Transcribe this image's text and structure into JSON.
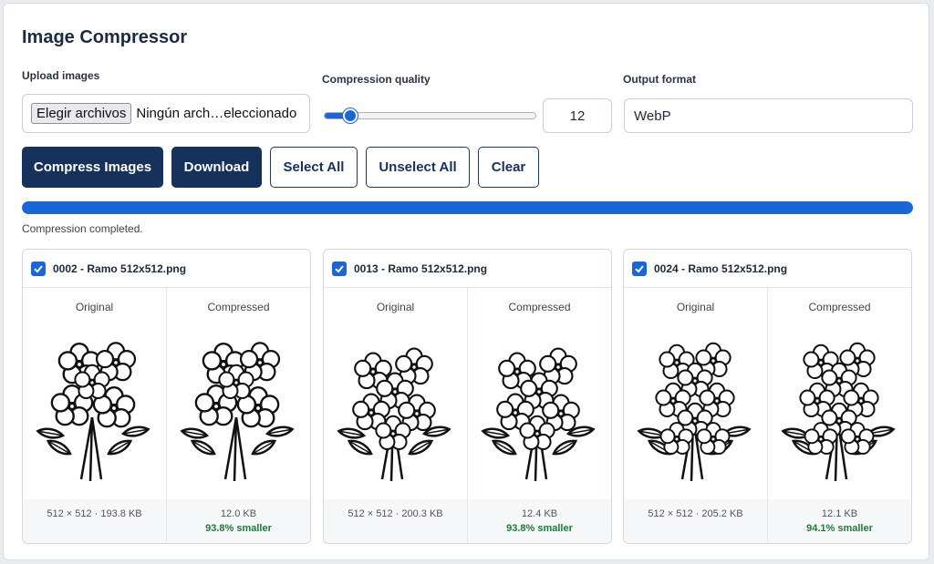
{
  "app": {
    "title": "Image Compressor"
  },
  "upload": {
    "label": "Upload images",
    "button": "Elegir archivos",
    "status": "Ningún arch…eleccionado"
  },
  "quality": {
    "label": "Compression quality",
    "value": "12",
    "level": 0.12
  },
  "format": {
    "label": "Output format",
    "selected": "WebP"
  },
  "actions": {
    "compress": "Compress Images",
    "download": "Download",
    "select_all": "Select All",
    "unselect_all": "Unselect All",
    "clear": "Clear"
  },
  "progress": {
    "value": 1.0,
    "status": "Compression completed."
  },
  "results": [
    {
      "name": "0002 - Ramo 512x512.png",
      "original_label": "Original",
      "compressed_label": "Compressed",
      "original_info": "512 × 512 · 193.8 KB",
      "compressed_size": "12.0 KB",
      "saving": "93.8% smaller",
      "checked": true
    },
    {
      "name": "0013 - Ramo 512x512.png",
      "original_label": "Original",
      "compressed_label": "Compressed",
      "original_info": "512 × 512 · 200.3 KB",
      "compressed_size": "12.4 KB",
      "saving": "93.8% smaller",
      "checked": true
    },
    {
      "name": "0024 - Ramo 512x512.png",
      "original_label": "Original",
      "compressed_label": "Compressed",
      "original_info": "512 × 512 · 205.2 KB",
      "compressed_size": "12.1 KB",
      "saving": "94.1% smaller",
      "checked": true
    }
  ],
  "colors": {
    "primary": "#16325a",
    "accent": "#1a66d6",
    "success": "#1f7a3a"
  }
}
